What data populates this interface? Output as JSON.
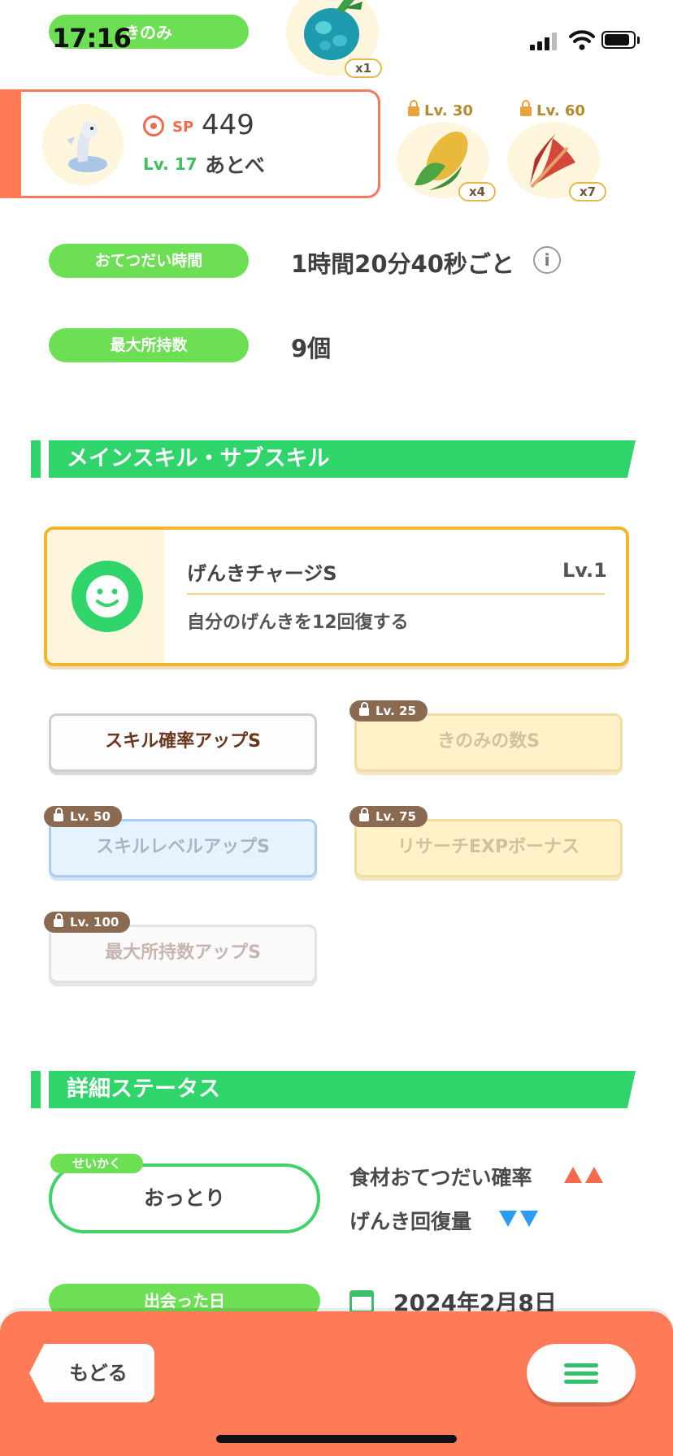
{
  "status_bar": {
    "time": "17:16"
  },
  "header": {
    "category_label": "きのみ",
    "main_berry": {
      "count": "x1",
      "icon": "berry-icon"
    },
    "berries": [
      {
        "level": "Lv. 30",
        "count": "x4",
        "icon": "corn-icon",
        "locked": true
      },
      {
        "level": "Lv. 60",
        "count": "x7",
        "icon": "cacao-icon",
        "locked": true
      }
    ]
  },
  "pokemon": {
    "sp_label": "SP",
    "sp_value": "449",
    "level": "Lv. 17",
    "nickname": "あとべ"
  },
  "info": {
    "help_time_label": "おてつだい時間",
    "help_time_value": "1時間20分40秒ごと",
    "max_carry_label": "最大所持数",
    "max_carry_value": "9個"
  },
  "skills_section": {
    "title": "メインスキル・サブスキル",
    "main_skill": {
      "name": "げんきチャージS",
      "level": "Lv.1",
      "description": "自分のげんきを12回復する"
    },
    "sub_skills": [
      {
        "name": "スキル確率アップS",
        "lock": ""
      },
      {
        "name": "きのみの数S",
        "lock": "Lv. 25"
      },
      {
        "name": "スキルレベルアップS",
        "lock": "Lv. 50"
      },
      {
        "name": "リサーチEXPボーナス",
        "lock": "Lv. 75"
      },
      {
        "name": "最大所持数アップS",
        "lock": "Lv. 100"
      }
    ]
  },
  "details_section": {
    "title": "詳細ステータス",
    "nature_tag": "せいかく",
    "nature": "おっとり",
    "effect_up": "食材おてつだい確率",
    "effect_down": "げんき回復量",
    "met_label": "出会った日",
    "met_date": "2024年2月8日"
  },
  "bottom": {
    "back_label": "もどる",
    "menu_icon": "hamburger-icon"
  },
  "colors": {
    "accent_green": "#2fd46a",
    "pill_green": "#6ddf55",
    "coral": "#ff7a56",
    "gold": "#f3b62a"
  }
}
